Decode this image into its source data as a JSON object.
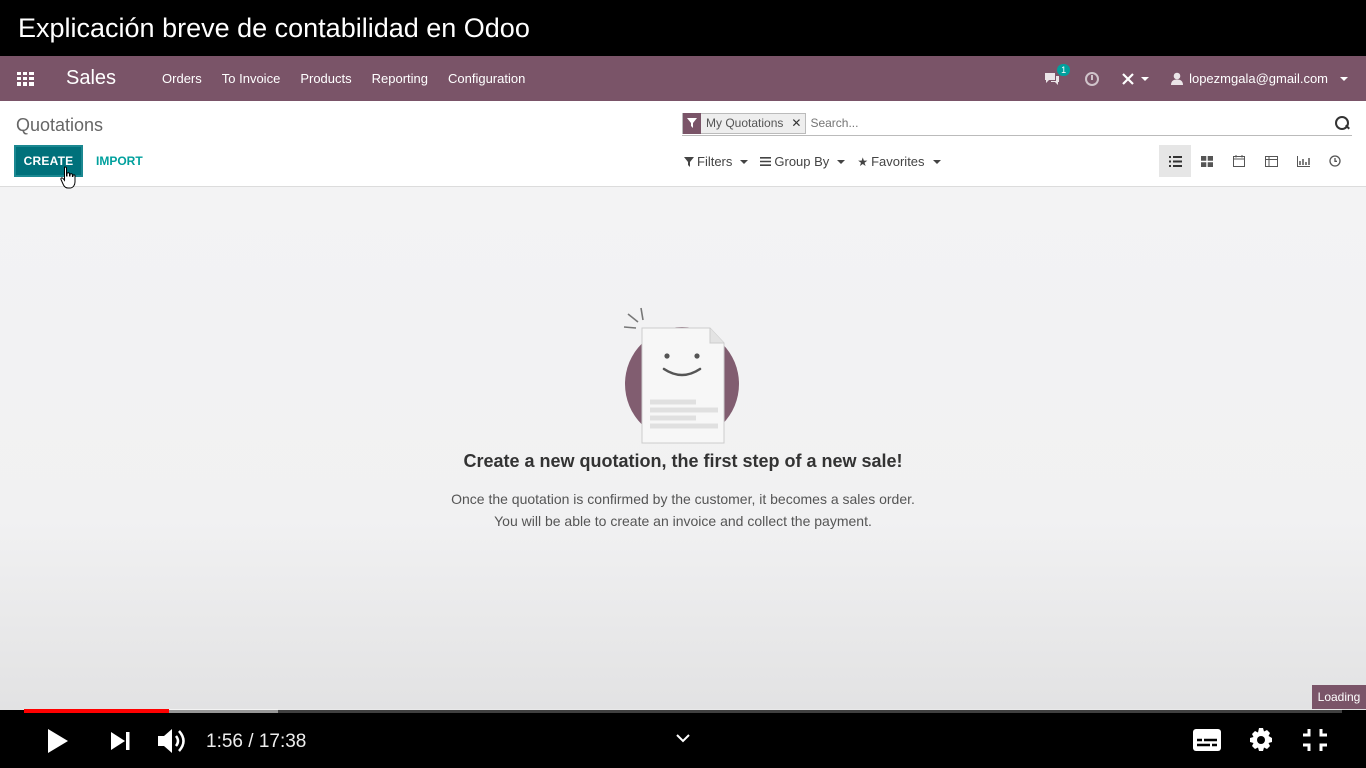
{
  "video": {
    "title": "Explicación breve de contabilidad en Odoo",
    "time_current": "1:56",
    "time_total": "17:38",
    "time_display": "1:56 / 17:38",
    "progress_fraction": 0.11,
    "buffer_fraction": 0.193,
    "loading_label": "Loading"
  },
  "topnav": {
    "app_name": "Sales",
    "menu": [
      "Orders",
      "To Invoice",
      "Products",
      "Reporting",
      "Configuration"
    ],
    "chat_badge": "1",
    "user_email": "lopezmgala@gmail.com"
  },
  "control_panel": {
    "breadcrumb": "Quotations",
    "search": {
      "facet_label": "My Quotations",
      "placeholder": "Search..."
    },
    "create_label": "CREATE",
    "import_label": "IMPORT",
    "filters_label": "Filters",
    "group_by_label": "Group By",
    "favorites_label": "Favorites"
  },
  "empty_state": {
    "title": "Create a new quotation, the first step of a new sale!",
    "line1": "Once the quotation is confirmed by the customer, it becomes a sales order.",
    "line2": "You will be able to create an invoice and collect the payment."
  },
  "colors": {
    "navbar": "#7a5468",
    "primary_button": "#00717b",
    "link": "#00a09d",
    "progress_played": "#ff0000"
  }
}
